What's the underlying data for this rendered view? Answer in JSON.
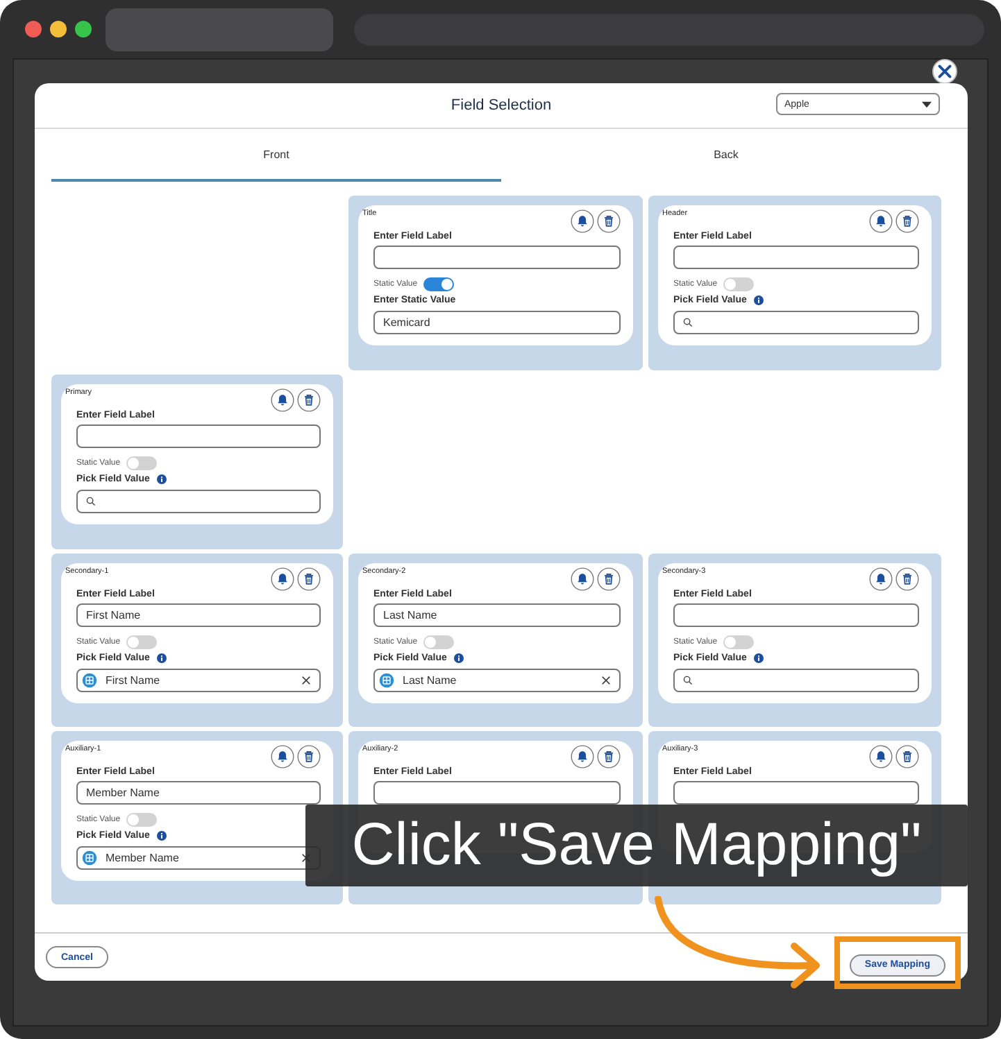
{
  "dialog": {
    "title": "Field Selection",
    "dropdown": "Apple"
  },
  "tabs": [
    {
      "label": "Front",
      "selected": true
    },
    {
      "label": "Back",
      "selected": false
    }
  ],
  "rows": [
    [
      null,
      {
        "slot": "Title",
        "label_heading": "Enter Field Label",
        "static_label": "Static Value",
        "static_on": true,
        "value_heading": "Enter Static Value",
        "value": {
          "kind": "text",
          "text": "Kemicard"
        }
      },
      {
        "slot": "Header",
        "label_heading": "Enter Field Label",
        "static_label": "Static Value",
        "static_on": false,
        "value_heading": "Pick Field Value",
        "value": {
          "kind": "search"
        }
      }
    ],
    [
      {
        "slot": "Primary",
        "label_heading": "Enter Field Label",
        "static_label": "Static Value",
        "static_on": false,
        "value_heading": "Pick Field Value",
        "value": {
          "kind": "search"
        }
      }
    ],
    [
      {
        "slot": "Secondary-1",
        "label_heading": "Enter Field Label",
        "label_value": "First Name",
        "static_label": "Static Value",
        "static_on": false,
        "value_heading": "Pick Field Value",
        "value": {
          "kind": "chip",
          "text": "First Name"
        }
      },
      {
        "slot": "Secondary-2",
        "label_heading": "Enter Field Label",
        "label_value": "Last Name",
        "static_label": "Static Value",
        "static_on": false,
        "value_heading": "Pick Field Value",
        "value": {
          "kind": "chip",
          "text": "Last Name"
        }
      },
      {
        "slot": "Secondary-3",
        "label_heading": "Enter Field Label",
        "static_label": "Static Value",
        "static_on": false,
        "value_heading": "Pick Field Value",
        "value": {
          "kind": "search"
        }
      }
    ],
    [
      {
        "slot": "Auxiliary-1",
        "label_heading": "Enter Field Label",
        "label_value": "Member Name",
        "static_label": "Static Value",
        "static_on": false,
        "value_heading": "Pick Field Value",
        "value": {
          "kind": "chip",
          "text": "Member Name"
        }
      },
      {
        "slot": "Auxiliary-2",
        "label_heading": "Enter Field Label"
      },
      {
        "slot": "Auxiliary-3",
        "label_heading": "Enter Field Label"
      }
    ]
  ],
  "footer": {
    "cancel": "Cancel",
    "save": "Save Mapping"
  },
  "annotation": {
    "text": "Click \"Save Mapping\""
  }
}
